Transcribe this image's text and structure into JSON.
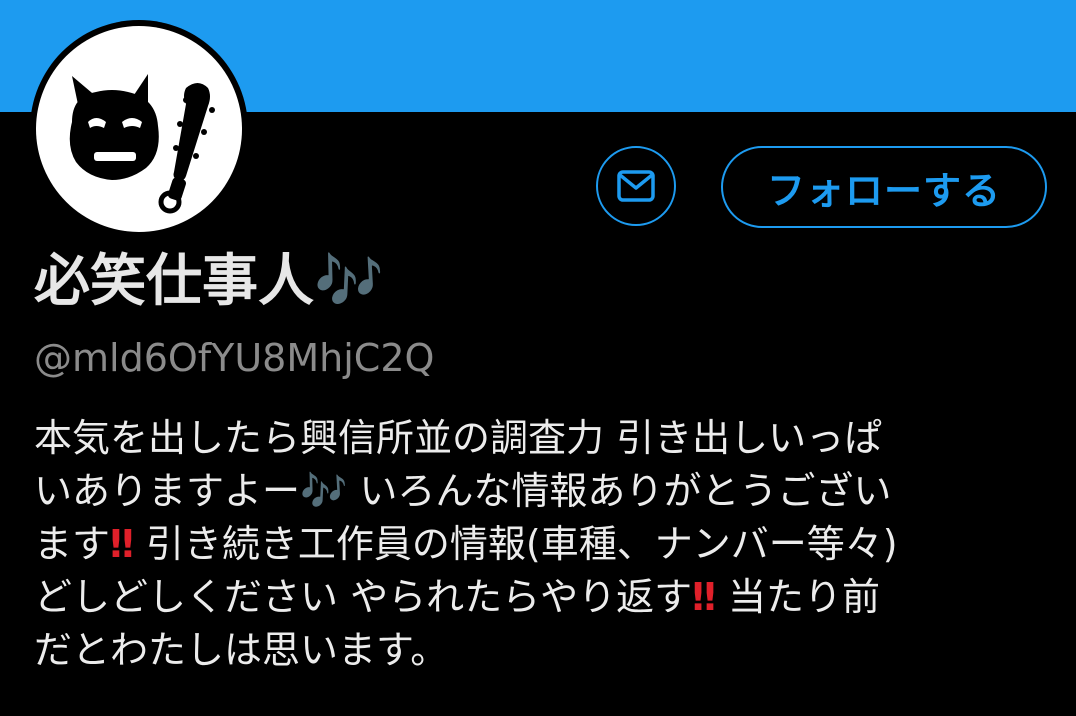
{
  "profile": {
    "display_name": "必笑仕事人",
    "display_name_emoji": "🎶",
    "handle": "@mld6OfYU8MhjC2Q",
    "avatar_icon": "oni-demon-with-club-icon"
  },
  "actions": {
    "message_icon": "envelope-icon",
    "follow_label": "フォローする"
  },
  "bio": {
    "line1": "本気を出したら興信所並の調査力 引き出しいっぱ",
    "line2a": "いありますよー",
    "line2_emoji": "🎶",
    "line2b": " いろんな情報ありがとうござい",
    "line3a": "ます",
    "line3_emoji": "‼",
    "line3b": " 引き続き工作員の情報(車種、ナンバー等々)",
    "line4a": "どしどしください  やられたらやり返す",
    "line4_emoji": "‼",
    "line4b": " 当たり前",
    "line5": "だとわたしは思います。"
  },
  "colors": {
    "accent": "#1d9bf0",
    "background": "#000000",
    "text": "#e7e7e7",
    "secondary_text": "#8b8b8b"
  }
}
